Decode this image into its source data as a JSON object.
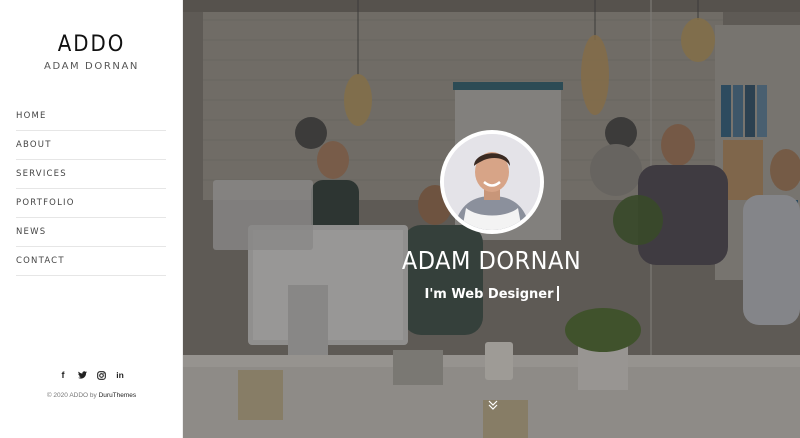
{
  "brand": {
    "logo": "ADDO",
    "subtitle": "ADAM DORNAN"
  },
  "nav": {
    "items": [
      {
        "label": "HOME"
      },
      {
        "label": "ABOUT"
      },
      {
        "label": "SERVICES"
      },
      {
        "label": "PORTFOLIO"
      },
      {
        "label": "NEWS"
      },
      {
        "label": "CONTACT"
      }
    ]
  },
  "social": {
    "icons": [
      "facebook-icon",
      "twitter-icon",
      "instagram-icon",
      "linkedin-icon"
    ]
  },
  "footer": {
    "copyright": "© 2020 ADDO by",
    "author": "DuruThemes"
  },
  "hero": {
    "name": "ADAM DORNAN",
    "role": "I'm Web Designer",
    "scroll_icon": "double-chevron-down-icon"
  },
  "colors": {
    "text_dark": "#111111",
    "hero_text": "#ffffff",
    "divider": "#e6e6e6"
  }
}
